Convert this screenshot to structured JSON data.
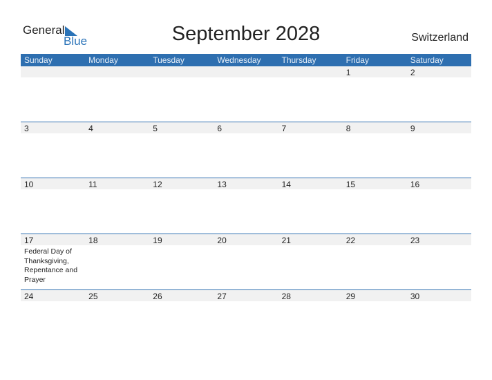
{
  "logo": {
    "general": "General",
    "blue": "Blue"
  },
  "title": "September 2028",
  "country": "Switzerland",
  "colors": {
    "accent": "#2e6fb0",
    "strip": "#f1f1f1"
  },
  "weekdays": [
    "Sunday",
    "Monday",
    "Tuesday",
    "Wednesday",
    "Thursday",
    "Friday",
    "Saturday"
  ],
  "weeks": [
    [
      "",
      "",
      "",
      "",
      "",
      "1",
      "2"
    ],
    [
      "3",
      "4",
      "5",
      "6",
      "7",
      "8",
      "9"
    ],
    [
      "10",
      "11",
      "12",
      "13",
      "14",
      "15",
      "16"
    ],
    [
      "17",
      "18",
      "19",
      "20",
      "21",
      "22",
      "23"
    ],
    [
      "24",
      "25",
      "26",
      "27",
      "28",
      "29",
      "30"
    ]
  ],
  "events": [
    {
      "week": 3,
      "day": 0,
      "text": "Federal Day of Thanksgiving, Repentance and Prayer"
    }
  ]
}
